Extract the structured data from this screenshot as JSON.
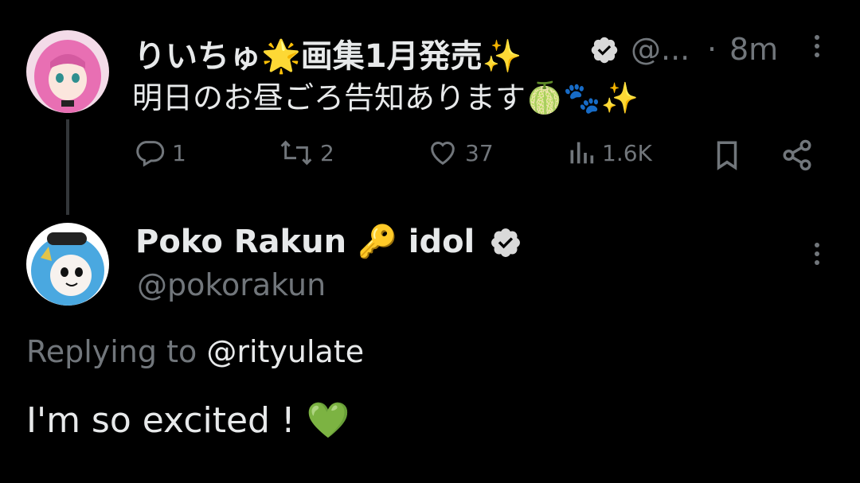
{
  "tweet": {
    "author_name": "りいちゅ🌟画集1月発売✨",
    "handle": "@...",
    "separator": "·",
    "time": "8m",
    "text": "明日のお昼ごろ告知あります🍈🐾✨",
    "actions": {
      "replies": "1",
      "reposts": "2",
      "likes": "37",
      "views": "1.6K"
    }
  },
  "reply": {
    "author_name": "Poko Rakun 🔑 idol",
    "handle": "@pokorakun",
    "replying_prefix": "Replying to",
    "replying_handle": "@rityulate",
    "text": "I'm so excited ! 💚"
  },
  "colors": {
    "background": "#000000",
    "text": "#e7e9ea",
    "secondary": "#71767b",
    "link": "#1d9bf0",
    "verified_badge": "#d9d9d9"
  },
  "icons": [
    "verified-badge-icon",
    "reply-icon",
    "repost-icon",
    "like-icon",
    "views-icon",
    "bookmark-icon",
    "share-icon",
    "more-icon"
  ]
}
